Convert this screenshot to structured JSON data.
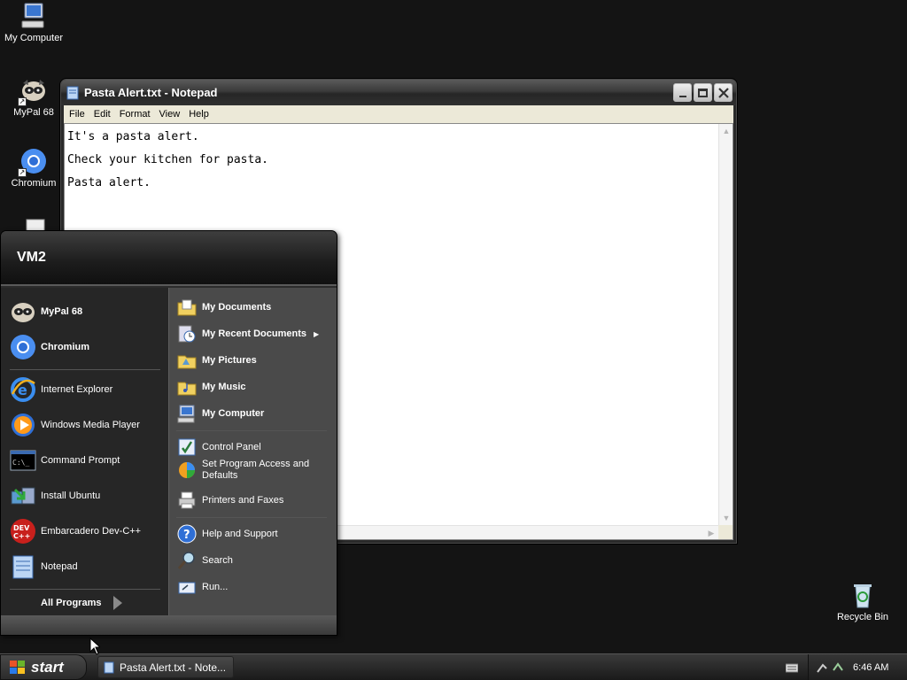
{
  "desktop": {
    "icons": [
      {
        "label": "My Computer"
      },
      {
        "label": "MyPal 68"
      },
      {
        "label": "Chromium"
      },
      {
        "label": "Recycle Bin"
      }
    ]
  },
  "notepad": {
    "title": "Pasta Alert.txt - Notepad",
    "menu": [
      "File",
      "Edit",
      "Format",
      "View",
      "Help"
    ],
    "lines": [
      "It's a pasta alert.",
      "Check your kitchen for pasta.",
      "Pasta alert."
    ]
  },
  "startmenu": {
    "user": "VM2",
    "pinned": [
      {
        "label": "MyPal 68",
        "icon": "mypal-icon"
      },
      {
        "label": "Chromium",
        "icon": "chromium-icon"
      }
    ],
    "recent": [
      {
        "label": "Internet Explorer",
        "icon": "ie-icon"
      },
      {
        "label": "Windows Media Player",
        "icon": "wmp-icon"
      },
      {
        "label": "Command Prompt",
        "icon": "cmd-icon"
      },
      {
        "label": "Install Ubuntu",
        "icon": "install-icon"
      },
      {
        "label": "Embarcadero Dev-C++",
        "icon": "devcpp-icon"
      },
      {
        "label": "Notepad",
        "icon": "notepad-icon"
      }
    ],
    "all_programs": "All Programs",
    "places": [
      {
        "label": "My Documents",
        "icon": "folder-documents-icon"
      },
      {
        "label": "My Recent Documents",
        "icon": "recent-documents-icon"
      },
      {
        "label": "My Pictures",
        "icon": "folder-pictures-icon"
      },
      {
        "label": "My Music",
        "icon": "folder-music-icon"
      },
      {
        "label": "My Computer",
        "icon": "computer-icon"
      }
    ],
    "system": [
      {
        "label": "Control Panel",
        "icon": "control-panel-icon"
      },
      {
        "label": "Set Program Access and Defaults",
        "icon": "program-access-icon"
      },
      {
        "label": "Printers and Faxes",
        "icon": "printer-icon"
      }
    ],
    "help": [
      {
        "label": "Help and Support",
        "icon": "help-icon"
      },
      {
        "label": "Search",
        "icon": "search-icon"
      },
      {
        "label": "Run...",
        "icon": "run-icon"
      }
    ]
  },
  "taskbar": {
    "start_label": "start",
    "task_label": "Pasta Alert.txt - Note...",
    "clock": "6:46 AM"
  }
}
